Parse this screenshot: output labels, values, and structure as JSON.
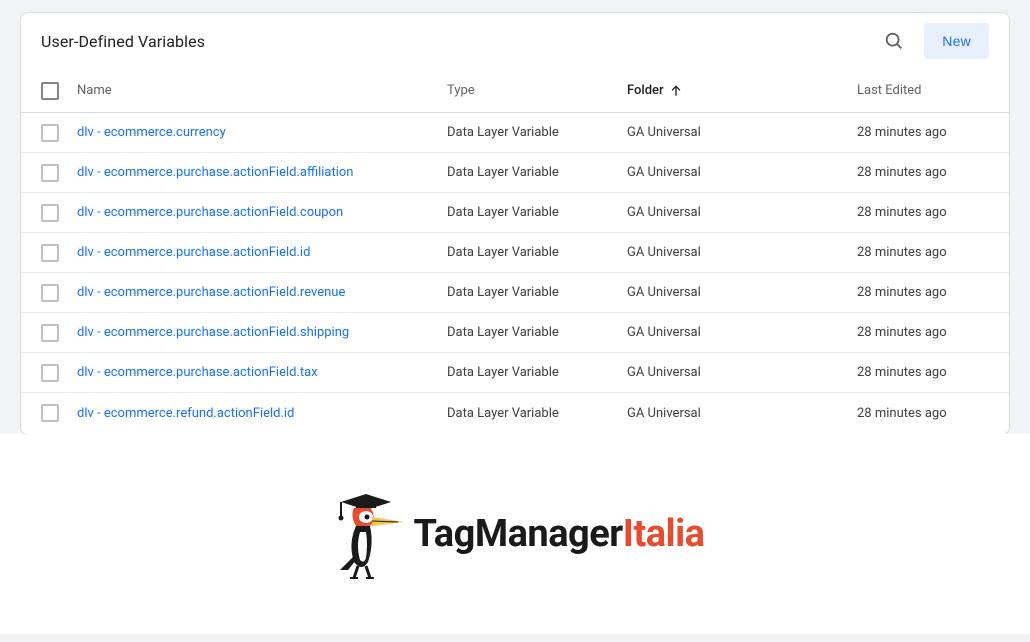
{
  "section": {
    "title": "User-Defined Variables",
    "new_button": "New"
  },
  "columns": {
    "name": "Name",
    "type": "Type",
    "folder": "Folder",
    "last_edited": "Last Edited"
  },
  "rows": [
    {
      "name": "dlv - ecommerce.currency",
      "type": "Data Layer Variable",
      "folder": "GA Universal",
      "last_edited": "28 minutes ago"
    },
    {
      "name": "dlv - ecommerce.purchase.actionField.affiliation",
      "type": "Data Layer Variable",
      "folder": "GA Universal",
      "last_edited": "28 minutes ago"
    },
    {
      "name": "dlv - ecommerce.purchase.actionField.coupon",
      "type": "Data Layer Variable",
      "folder": "GA Universal",
      "last_edited": "28 minutes ago"
    },
    {
      "name": "dlv - ecommerce.purchase.actionField.id",
      "type": "Data Layer Variable",
      "folder": "GA Universal",
      "last_edited": "28 minutes ago"
    },
    {
      "name": "dlv - ecommerce.purchase.actionField.revenue",
      "type": "Data Layer Variable",
      "folder": "GA Universal",
      "last_edited": "28 minutes ago"
    },
    {
      "name": "dlv - ecommerce.purchase.actionField.shipping",
      "type": "Data Layer Variable",
      "folder": "GA Universal",
      "last_edited": "28 minutes ago"
    },
    {
      "name": "dlv - ecommerce.purchase.actionField.tax",
      "type": "Data Layer Variable",
      "folder": "GA Universal",
      "last_edited": "28 minutes ago"
    },
    {
      "name": "dlv - ecommerce.refund.actionField.id",
      "type": "Data Layer Variable",
      "folder": "GA Universal",
      "last_edited": "28 minutes ago"
    }
  ],
  "logo": {
    "part1": "TagManager",
    "part2": "Italia"
  }
}
